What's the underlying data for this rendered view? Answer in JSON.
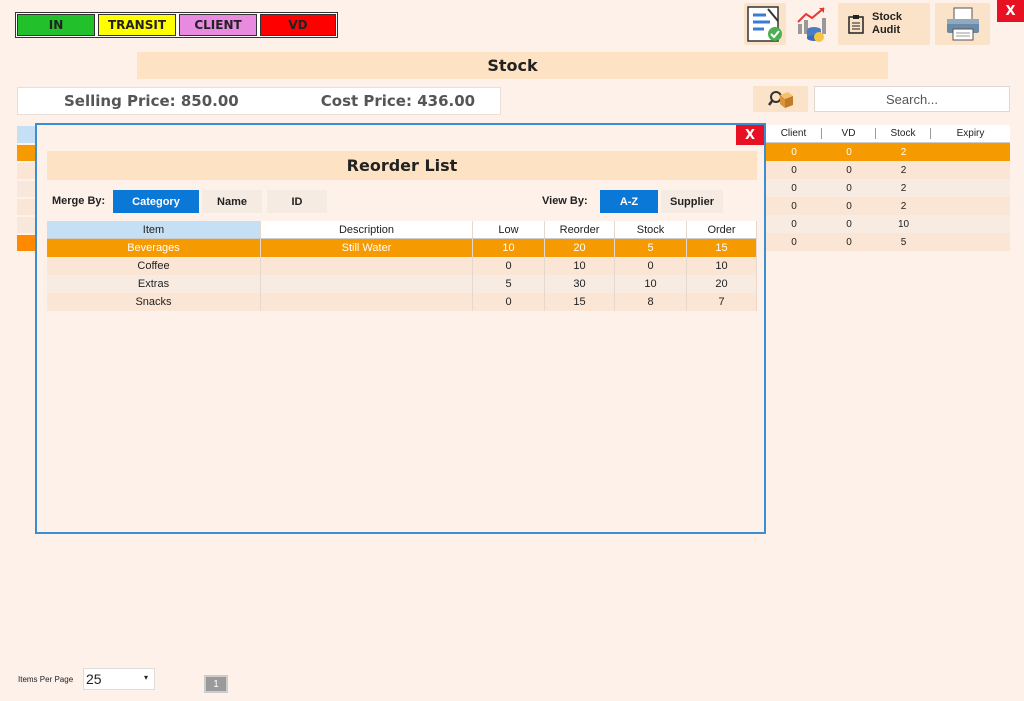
{
  "legend": [
    {
      "label": "IN",
      "color": "#22c02b"
    },
    {
      "label": "TRANSIT",
      "color": "#ffff00"
    },
    {
      "label": "CLIENT",
      "color": "#e88ae0"
    },
    {
      "label": "VD",
      "color": "#ff0000"
    }
  ],
  "close_label": "X",
  "toolbar": {
    "audit_label_1": "Stock",
    "audit_label_2": "Audit",
    "icons": [
      "stock-check-icon",
      "database-chart-icon",
      "clipboard-icon",
      "printer-icon"
    ]
  },
  "stock_title": "Stock",
  "prices": {
    "selling": "Selling Price: 850.00",
    "cost": "Cost Price: 436.00"
  },
  "search": {
    "placeholder": "Search..."
  },
  "bg_table": {
    "headers": [
      "Client",
      "VD",
      "Stock",
      "Expiry"
    ],
    "rows": [
      [
        "0",
        "0",
        "2",
        ""
      ],
      [
        "0",
        "0",
        "2",
        ""
      ],
      [
        "0",
        "0",
        "2",
        ""
      ],
      [
        "0",
        "0",
        "2",
        ""
      ],
      [
        "0",
        "0",
        "10",
        ""
      ],
      [
        "0",
        "0",
        "5",
        ""
      ]
    ]
  },
  "modal": {
    "title": "Reorder List",
    "close_label": "X",
    "merge_by_label": "Merge By:",
    "merge_options": [
      "Category",
      "Name",
      "ID"
    ],
    "view_by_label": "View By:",
    "view_options": [
      "A-Z",
      "Supplier"
    ],
    "headers": [
      "Item",
      "Description",
      "Low",
      "Reorder",
      "Stock",
      "Order"
    ],
    "rows": [
      [
        "Beverages",
        "Still Water",
        "10",
        "20",
        "5",
        "15"
      ],
      [
        "Coffee",
        "",
        "0",
        "10",
        "0",
        "10"
      ],
      [
        "Extras",
        "",
        "5",
        "30",
        "10",
        "20"
      ],
      [
        "Snacks",
        "",
        "0",
        "15",
        "8",
        "7"
      ]
    ]
  },
  "footer": {
    "items_per_page_label": "Items Per Page",
    "items_per_page_value": "25",
    "dropdown_glyph": "▾",
    "page": "1"
  }
}
